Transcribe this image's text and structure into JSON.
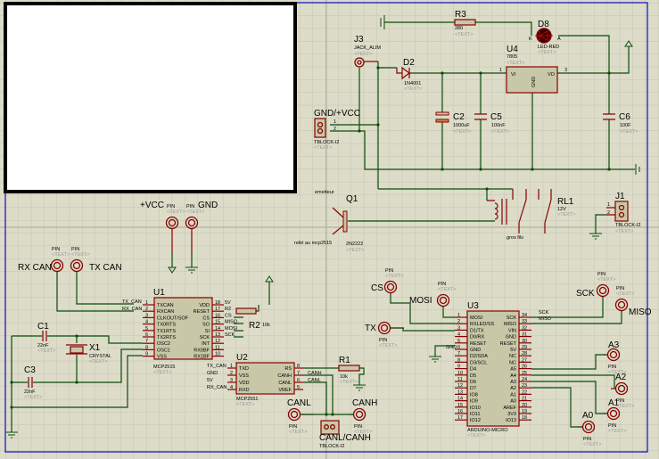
{
  "colors": {
    "background": "#dcdcc8",
    "grid": "#c3c3b0",
    "wire": "#0b4d0b",
    "pin": "#8a0000",
    "component_fill": "#c8c8a8",
    "sheet_border": "#1a1acc"
  },
  "placeholder": "<TEXT>",
  "pin_label": "PIN",
  "r3": {
    "ref": "R3",
    "value": "280"
  },
  "d8": {
    "ref": "D8",
    "value": "LED-RED",
    "k": "K",
    "a": "A"
  },
  "j3": {
    "ref": "J3",
    "value": "JACK_ALIM"
  },
  "d2": {
    "ref": "D2",
    "value": "1N4001"
  },
  "u4": {
    "ref": "U4",
    "value": "7805",
    "vi": "VI",
    "vo": "VO",
    "gnd": "GND",
    "p1": "1",
    "p3": "3"
  },
  "c2": {
    "ref": "C2",
    "value": "1000uF"
  },
  "c5": {
    "ref": "C5",
    "value": "100nF"
  },
  "c6": {
    "ref": "C6",
    "value": "100F"
  },
  "j_power": {
    "ref": "GND/+VCC",
    "value": "TBLOCK-I2",
    "p1": "1",
    "p2": "2"
  },
  "q1": {
    "ref": "Q1",
    "value": "2N2222",
    "emitter_note": "emetteur",
    "base_note": "relié au mcp2515"
  },
  "rl1": {
    "ref": "RL1",
    "value": "12V",
    "note": "gros fils"
  },
  "j1": {
    "ref": "J1",
    "value": "TBLOCK-I2",
    "p1": "1",
    "p2": "2"
  },
  "pins": {
    "vcc": "+VCC",
    "gnd": "GND",
    "rx_can": "RX CAN",
    "tx_can": "TX CAN",
    "cs": "CS",
    "mosi": "MOSI",
    "tx": "TX",
    "sck": "SCK",
    "miso": "MISO",
    "a3": "A3",
    "a2": "A2",
    "a1": "A1",
    "a0": "A0",
    "canl": "CANL",
    "canh": "CANH"
  },
  "u1": {
    "ref": "U1",
    "value": "MCP2515",
    "left": [
      [
        "TXCAN",
        "1"
      ],
      [
        "RXCAN",
        "2"
      ],
      [
        "CLKOUT/SOF",
        "3"
      ],
      [
        "TX0RTS",
        "4"
      ],
      [
        "TX1RTS",
        "5"
      ],
      [
        "TX2RTS",
        "6"
      ],
      [
        "OSC2",
        "7"
      ],
      [
        "OSC1",
        "8"
      ],
      [
        "VSS",
        "9"
      ]
    ],
    "right": [
      [
        "VDD",
        "18"
      ],
      [
        "RESET",
        "17"
      ],
      [
        "CS",
        "16"
      ],
      [
        "SO",
        "15"
      ],
      [
        "SI",
        "14"
      ],
      [
        "SCK",
        "13"
      ],
      [
        "INT",
        "12"
      ],
      [
        "RX0BF",
        "11"
      ],
      [
        "RX1BF",
        "10"
      ]
    ],
    "net_left": [
      "TX_CAN",
      "RX_CAN"
    ],
    "net_right": [
      "5V",
      "R2",
      "CS",
      "MISO",
      "MOSI",
      "SCK"
    ]
  },
  "r2": {
    "ref": "R2",
    "value": "10k"
  },
  "c1": {
    "ref": "C1",
    "value": "22nF"
  },
  "c3": {
    "ref": "C3",
    "value": "22nF"
  },
  "x1": {
    "ref": "X1",
    "value": "CRYSTAL"
  },
  "u2": {
    "ref": "U2",
    "value": "MCP2551",
    "left": [
      [
        "TXD",
        "1"
      ],
      [
        "VSS",
        "2"
      ],
      [
        "VDD",
        "3"
      ],
      [
        "RXD",
        "4"
      ]
    ],
    "right": [
      [
        "RS",
        "8"
      ],
      [
        "CANH",
        "7"
      ],
      [
        "CANL",
        "6"
      ],
      [
        "VREF",
        "5"
      ]
    ],
    "net_left": [
      "TX_CAN",
      "GND",
      "5V",
      "RX_CAN"
    ],
    "net_right": [
      "CANH",
      "CANL"
    ]
  },
  "r1": {
    "ref": "R1",
    "value": "10k"
  },
  "j_can": {
    "ref": "CANL/CANH",
    "value": "TBLOCK-I2"
  },
  "u3": {
    "ref": "U3",
    "value": "ARDUINO-MICRO",
    "left": [
      [
        "MOSI",
        "1"
      ],
      [
        "RXLED/SS",
        "2"
      ],
      [
        "D1/TX",
        "3"
      ],
      [
        "D0/RX",
        "4"
      ],
      [
        "RESET",
        "5"
      ],
      [
        "GND",
        "6"
      ],
      [
        "D2/SDA",
        "7"
      ],
      [
        "D3/SCL",
        "8"
      ],
      [
        "D4",
        "9"
      ],
      [
        "D5",
        "10"
      ],
      [
        "D6",
        "11"
      ],
      [
        "D7",
        "12"
      ],
      [
        "IO8",
        "13"
      ],
      [
        "IO9",
        "14"
      ],
      [
        "IO10",
        "15"
      ],
      [
        "IO11",
        "16"
      ],
      [
        "IO12",
        "17"
      ]
    ],
    "right": [
      [
        "SCK",
        "34"
      ],
      [
        "MISO",
        "33"
      ],
      [
        "VIN",
        "32"
      ],
      [
        "GND",
        "31"
      ],
      [
        "RESET",
        "30"
      ],
      [
        "5V",
        "29"
      ],
      [
        "NC",
        "28"
      ],
      [
        "NC",
        "27"
      ],
      [
        "A5",
        "26"
      ],
      [
        "A4",
        "25"
      ],
      [
        "A3",
        "24"
      ],
      [
        "A2",
        "23"
      ],
      [
        "A1",
        "22"
      ],
      [
        "A0",
        "21"
      ],
      [
        "AREF",
        "20"
      ],
      [
        "3V3",
        "19"
      ],
      [
        "IO13",
        "18"
      ]
    ],
    "net_left": "GND",
    "net_right": [
      "SCK",
      "MISO"
    ]
  }
}
